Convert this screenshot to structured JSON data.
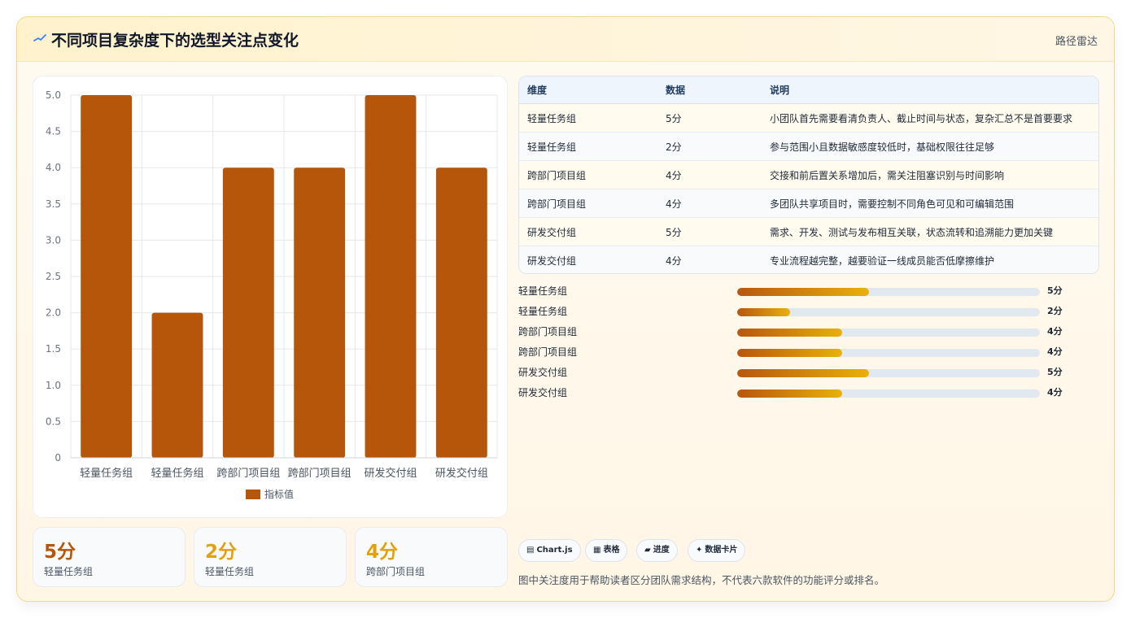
{
  "header": {
    "title": "不同项目复杂度下的选型关注点变化",
    "tag": "路径雷达",
    "icon": "trend-line-icon"
  },
  "colors": {
    "bar": "#b5560a",
    "accent_dark": "#b8560f",
    "accent_gold": "#e8b10a",
    "grid": "#e5e7eb"
  },
  "chart_data": {
    "type": "bar",
    "categories": [
      "轻量任务组",
      "轻量任务组",
      "跨部门项目组",
      "跨部门项目组",
      "研发交付组",
      "研发交付组"
    ],
    "series": [
      {
        "name": "指标值",
        "values": [
          5,
          2,
          4,
          4,
          5,
          4
        ]
      }
    ],
    "yticks": [
      "0",
      "0.5",
      "1.0",
      "1.5",
      "2.0",
      "2.5",
      "3.0",
      "3.5",
      "4.0",
      "4.5",
      "5.0"
    ],
    "ylim": [
      0,
      5
    ],
    "grid": true,
    "legend": "bottom"
  },
  "stats": [
    {
      "value": "5分",
      "label": "轻量任务组",
      "color": "#b5560a"
    },
    {
      "value": "2分",
      "label": "轻量任务组",
      "color": "#e3a10b"
    },
    {
      "value": "4分",
      "label": "跨部门项目组",
      "color": "#e3a10b"
    }
  ],
  "table": {
    "headers": [
      "维度",
      "数据",
      "说明"
    ],
    "rows": [
      [
        "轻量任务组",
        "5分",
        "小团队首先需要看清负责人、截止时间与状态，复杂汇总不是首要要求"
      ],
      [
        "轻量任务组",
        "2分",
        "参与范围小且数据敏感度较低时，基础权限往往足够"
      ],
      [
        "跨部门项目组",
        "4分",
        "交接和前后置关系增加后，需关注阻塞识别与时间影响"
      ],
      [
        "跨部门项目组",
        "4分",
        "多团队共享项目时，需要控制不同角色可见和可编辑范围"
      ],
      [
        "研发交付组",
        "5分",
        "需求、开发、测试与发布相互关联，状态流转和追溯能力更加关键"
      ],
      [
        "研发交付组",
        "4分",
        "专业流程越完整，越要验证一线成员能否低摩擦维护"
      ]
    ]
  },
  "progress": [
    {
      "label": "轻量任务组",
      "value": 5,
      "text": "5分"
    },
    {
      "label": "轻量任务组",
      "value": 2,
      "text": "2分"
    },
    {
      "label": "跨部门项目组",
      "value": 4,
      "text": "4分"
    },
    {
      "label": "跨部门项目组",
      "value": 4,
      "text": "4分"
    },
    {
      "label": "研发交付组",
      "value": 5,
      "text": "5分"
    },
    {
      "label": "研发交付组",
      "value": 4,
      "text": "4分"
    }
  ],
  "progress_max": 11.5,
  "chips": [
    {
      "icon": "chart-icon",
      "glyph": "▤",
      "label": "Chart.js"
    },
    {
      "icon": "table-icon",
      "glyph": "▦",
      "label": "表格"
    },
    {
      "icon": "progress-icon",
      "glyph": "▰",
      "label": "进度"
    },
    {
      "icon": "sparkle-icon",
      "glyph": "✦",
      "label": "数据卡片"
    }
  ],
  "note": "图中关注度用于帮助读者区分团队需求结构，不代表六款软件的功能评分或排名。"
}
